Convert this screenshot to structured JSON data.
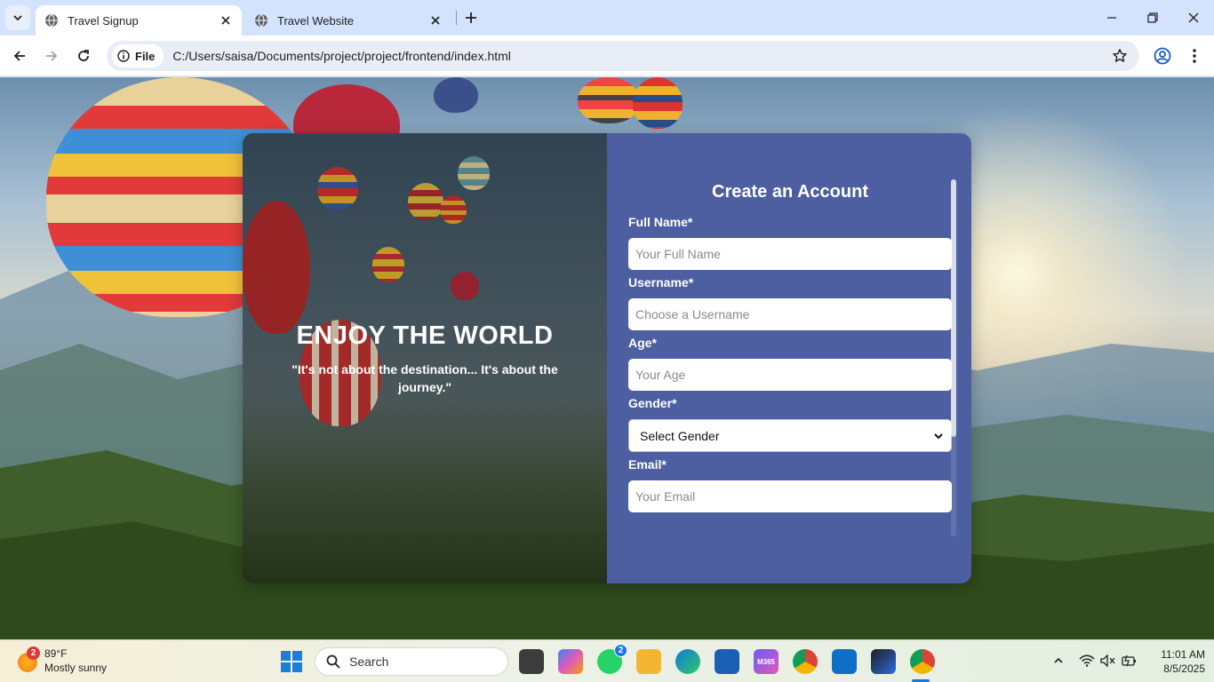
{
  "browser": {
    "tabs": [
      {
        "title": "Travel Signup",
        "active": true
      },
      {
        "title": "Travel Website",
        "active": false
      }
    ],
    "site_chip": "File",
    "url": "C:/Users/saisa/Documents/project/project/frontend/index.html"
  },
  "page": {
    "hero": {
      "title": "ENJOY THE WORLD",
      "quote": "\"It's not about the destination... It's about the journey.\""
    },
    "form": {
      "title": "Create an Account",
      "fields": [
        {
          "label": "Full Name*",
          "placeholder": "Your Full Name"
        },
        {
          "label": "Username*",
          "placeholder": "Choose a Username"
        },
        {
          "label": "Age*",
          "placeholder": "Your Age"
        },
        {
          "label": "Gender*",
          "selected": "Select Gender"
        },
        {
          "label": "Email*",
          "placeholder": "Your Email"
        }
      ]
    },
    "colors": {
      "form_panel": "#4d5fa0",
      "accent": "#1a73e8"
    }
  },
  "taskbar": {
    "weather": {
      "badge": "2",
      "temp": "89°F",
      "condition": "Mostly sunny"
    },
    "search_label": "Search",
    "whatsapp_badge": "2",
    "m365_label": "M365",
    "clock": {
      "time": "11:01 AM",
      "date": "8/5/2025"
    },
    "apps": [
      "copilot-icon",
      "whatsapp-icon",
      "file-explorer-icon",
      "edge-icon",
      "store-icon",
      "m365-icon",
      "chrome-icon",
      "vscode-icon",
      "webstorm-icon",
      "chrome-icon"
    ]
  }
}
